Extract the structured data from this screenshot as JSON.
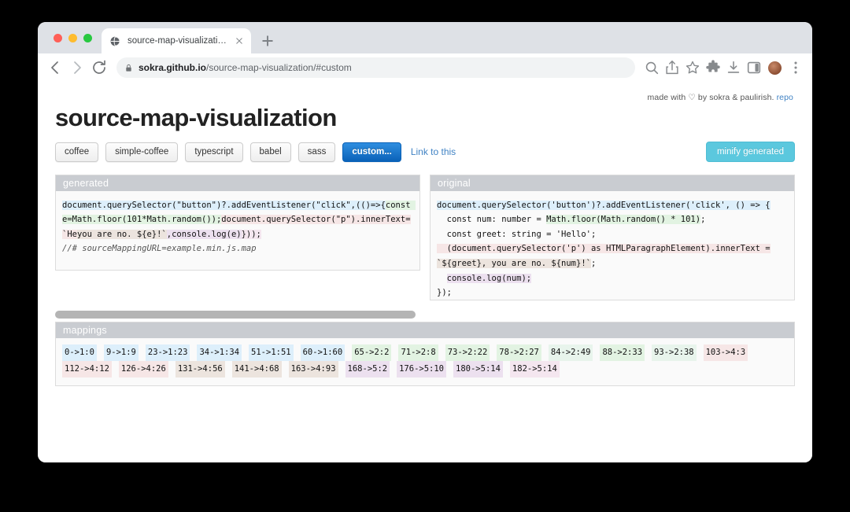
{
  "browser": {
    "tab": {
      "title": "source-map-visualization",
      "favicon_icon": "globe-icon",
      "close_icon": "close-icon"
    },
    "newtab_icon": "plus-icon",
    "back_icon": "back-arrow-icon",
    "forward_icon": "forward-arrow-icon",
    "reload_icon": "reload-icon",
    "lock_icon": "lock-icon",
    "url_domain": "sokra.github.io",
    "url_path": "/source-map-visualization/#custom",
    "toolbar_icons": [
      "search-icon",
      "share-icon",
      "bookmark-star-icon",
      "extensions-puzzle-icon",
      "download-icon",
      "side-panel-icon",
      "profile-avatar",
      "chrome-menu-icon"
    ]
  },
  "page": {
    "credits_prefix": "made with",
    "credits_heart": "♡",
    "credits_suffix": "by sokra & paulirish.",
    "repo_link": "repo",
    "title": "source-map-visualization",
    "tabs": [
      {
        "label": "coffee",
        "active": false
      },
      {
        "label": "simple-coffee",
        "active": false
      },
      {
        "label": "typescript",
        "active": false
      },
      {
        "label": "babel",
        "active": false
      },
      {
        "label": "sass",
        "active": false
      },
      {
        "label": "custom...",
        "active": true
      }
    ],
    "link_to_this": "Link to this",
    "minify_button": "minify generated",
    "accent_blue": "#0a62b8",
    "accent_cyan": "#5bc8de",
    "link_color": "#4183c4"
  },
  "generated": {
    "header": "generated",
    "segments": [
      {
        "text": "document.querySelector(\"button\")?.addEventListener(\"click\",(()=>{",
        "tint": "m0"
      },
      {
        "text": "const e=Math.floor(101*Math.random());",
        "tint": "m1"
      },
      {
        "text": "document.querySelector(\"p\").innerText=`He",
        "tint": "m2"
      },
      {
        "text": "you are no. ${e}!`",
        "tint": "m3"
      },
      {
        "text": ",console.log(e)",
        "tint": "m4"
      },
      {
        "text": "}));",
        "tint": "m5"
      }
    ],
    "comment": "//# sourceMappingURL=example.min.js.map"
  },
  "original": {
    "header": "original",
    "lines": [
      [
        {
          "text": "document.querySelector('button')?.addEventListener('click', () => {",
          "tint": "m0"
        }
      ],
      [
        {
          "text": "  const num: number = ",
          "tint": ""
        },
        {
          "text": "Math.floor(Math.random() * 101)",
          "tint": "m1"
        },
        {
          "text": ";",
          "tint": ""
        }
      ],
      [
        {
          "text": "  const greet: string = 'Hello';",
          "tint": ""
        }
      ],
      [
        {
          "text": "  (document.querySelector('p') as HTMLParagraphElement).innerText =",
          "tint": "m2"
        }
      ],
      [
        {
          "text": "`${greet}, you are no. ${num}!`",
          "tint": "m3"
        },
        {
          "text": ";",
          "tint": ""
        }
      ],
      [
        {
          "text": "  ",
          "tint": ""
        },
        {
          "text": "console.log(num);",
          "tint": "m4"
        }
      ],
      [
        {
          "text": "});",
          "tint": ""
        }
      ]
    ]
  },
  "mappings": {
    "header": "mappings",
    "tokens": [
      {
        "label": "0->1:0",
        "tint": "m0"
      },
      {
        "label": "9->1:9",
        "tint": "m0"
      },
      {
        "label": "23->1:23",
        "tint": "m0"
      },
      {
        "label": "34->1:34",
        "tint": "m0"
      },
      {
        "label": "51->1:51",
        "tint": "m0"
      },
      {
        "label": "60->1:60",
        "tint": "m0"
      },
      {
        "label": "65->2:2",
        "tint": "m1"
      },
      {
        "label": "71->2:8",
        "tint": "m1"
      },
      {
        "label": "73->2:22",
        "tint": "m1"
      },
      {
        "label": "78->2:27",
        "tint": "m1"
      },
      {
        "label": "84->2:49",
        "tint": "m6"
      },
      {
        "label": "88->2:33",
        "tint": "m1"
      },
      {
        "label": "93->2:38",
        "tint": "m6"
      },
      {
        "label": "103->4:3",
        "tint": "m2"
      },
      {
        "label": "112->4:12",
        "tint": "m2"
      },
      {
        "label": "126->4:26",
        "tint": "m2"
      },
      {
        "label": "131->4:56",
        "tint": "m3"
      },
      {
        "label": "141->4:68",
        "tint": "m3"
      },
      {
        "label": "163->4:93",
        "tint": "m3"
      },
      {
        "label": "168->5:2",
        "tint": "m4"
      },
      {
        "label": "176->5:10",
        "tint": "m4"
      },
      {
        "label": "180->5:14",
        "tint": "m4"
      },
      {
        "label": "182->5:14",
        "tint": "m5"
      }
    ]
  }
}
